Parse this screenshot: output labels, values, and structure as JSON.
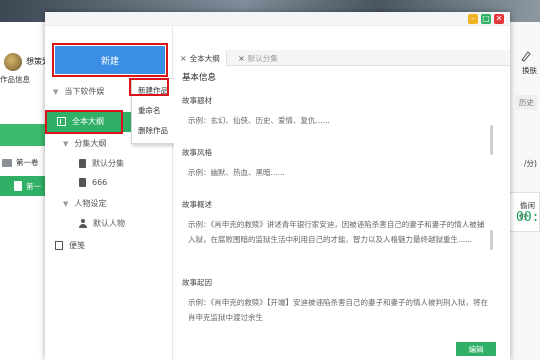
{
  "background_app": {
    "username": "想策划",
    "info_label": "作品信息",
    "volume_label": "第一卷",
    "chapter_label": "第一",
    "skin_label": "换肤",
    "history_label": "历史",
    "fraction_text": "/分)",
    "duration_label": "偷闲时",
    "timer_text": "00:0"
  },
  "dialog": {
    "window_controls": [
      "minimize",
      "maximize",
      "close"
    ],
    "new_button_label": "新建",
    "tree": {
      "section_label": "当下软件娱",
      "active_item": "全本大纲",
      "outline_group": "分集大纲",
      "outline_children": [
        "默认分集",
        "666"
      ],
      "character_group": "人物设定",
      "character_children": [
        "默认人物"
      ],
      "notes_item": "便笺"
    },
    "context_menu": [
      "新建作品",
      "重命名",
      "删除作品"
    ],
    "tabs": [
      {
        "label": "全本大纲",
        "active": true
      },
      {
        "label": "默认分集",
        "active": false
      }
    ],
    "content": {
      "title": "基本信息",
      "sections": [
        {
          "label": "故事题材",
          "body": "示例：玄幻、仙侠、历史、爱情、复仇......"
        },
        {
          "label": "故事风格",
          "body": "示例：幽默、热血、黑暗......"
        },
        {
          "label": "故事概述",
          "body": "示例：《肖申克的救赎》讲述青年银行家安迪，因被诬陷杀害自己的妻子和妻子的情人被捕入狱，在腐败围暗的监狱生活中利用自己的才能、智力以及人格魅力最终越狱重生......"
        },
        {
          "label": "故事起因",
          "body": "示例：《肖申克的救赎》【开端】安迪被诬陷杀害自己的妻子和妻子的情人被判刑入狱，将在肖申克监狱中渡过余生"
        }
      ]
    },
    "edit_button_label": "编辑"
  },
  "colors": {
    "accent_green": "#2fb066",
    "accent_blue": "#3a8ee6",
    "highlight_red": "#d9141b"
  }
}
